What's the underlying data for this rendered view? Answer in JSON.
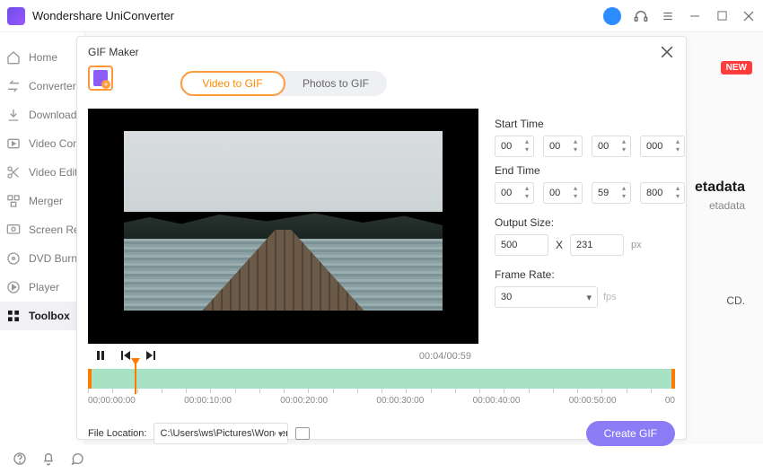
{
  "app": {
    "title": "Wondershare UniConverter"
  },
  "sidebar": {
    "items": [
      {
        "label": "Home"
      },
      {
        "label": "Converter"
      },
      {
        "label": "Downloader"
      },
      {
        "label": "Video Compressor"
      },
      {
        "label": "Video Editor"
      },
      {
        "label": "Merger"
      },
      {
        "label": "Screen Recorder"
      },
      {
        "label": "DVD Burner"
      },
      {
        "label": "Player"
      },
      {
        "label": "Toolbox"
      }
    ]
  },
  "badges": {
    "new": "NEW"
  },
  "bg": {
    "hint1": "etadata",
    "hint2": "etadata",
    "hint3": "CD."
  },
  "modal": {
    "title": "GIF Maker",
    "tabs": {
      "video": "Video to GIF",
      "photos": "Photos to GIF"
    },
    "player_time": "00:04/00:59",
    "start_label": "Start Time",
    "start": {
      "h": "00",
      "m": "00",
      "s": "00",
      "ms": "000"
    },
    "end_label": "End Time",
    "end": {
      "h": "00",
      "m": "00",
      "s": "59",
      "ms": "800"
    },
    "output_label": "Output Size:",
    "out_w": "500",
    "out_x": "X",
    "out_h": "231",
    "px": "px",
    "fr_label": "Frame Rate:",
    "fr_value": "30",
    "fps": "fps",
    "timeline": {
      "labels": [
        "00:00:00:00",
        "00:00:10:00",
        "00:00:20:00",
        "00:00:30:00",
        "00:00:40:00",
        "00:00:50:00",
        "00"
      ]
    },
    "file_loc_label": "File Location:",
    "file_loc_value": "C:\\Users\\ws\\Pictures\\Wonders",
    "create": "Create GIF"
  }
}
